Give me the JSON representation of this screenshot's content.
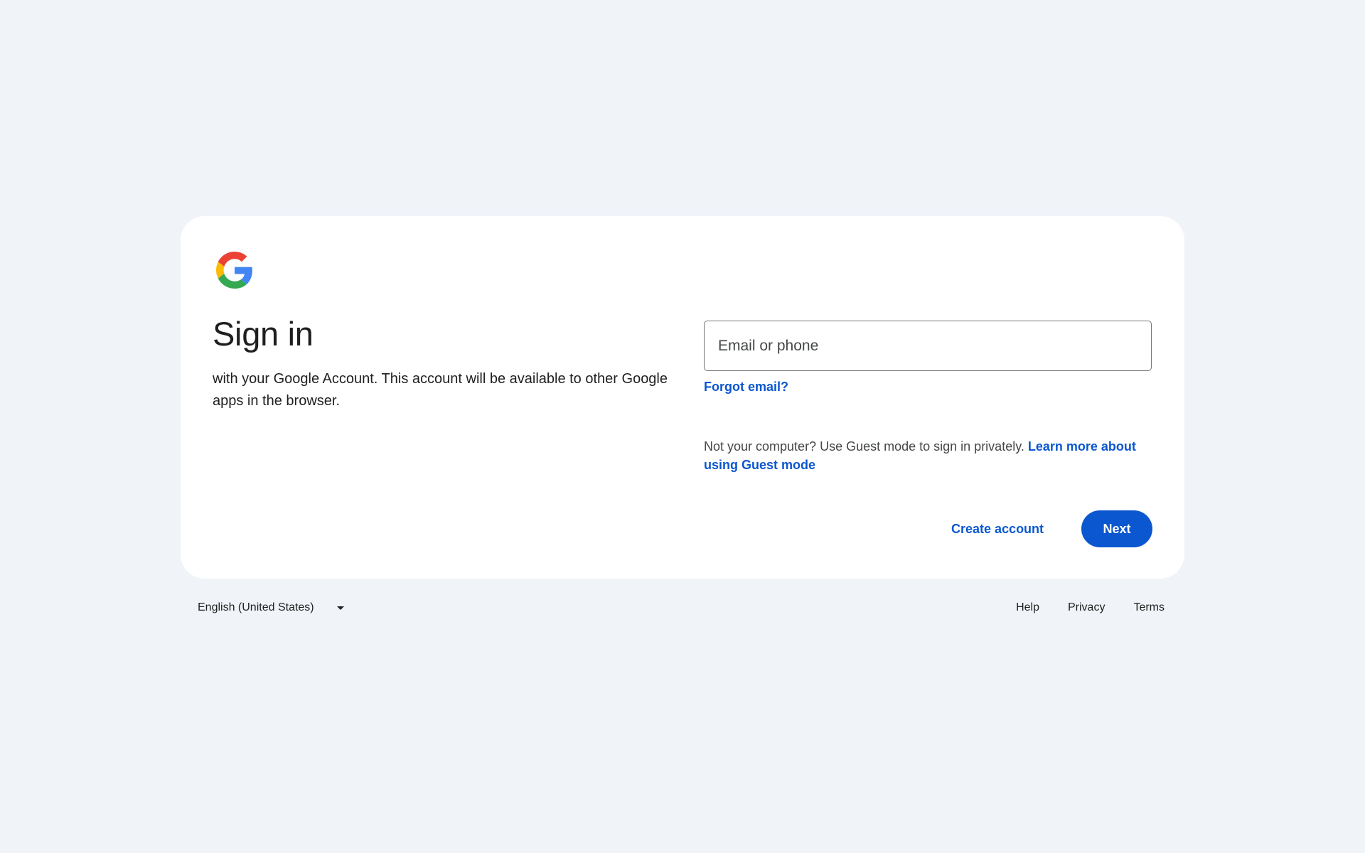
{
  "card": {
    "title": "Sign in",
    "subtitle": "with your Google Account. This account will be available to other Google apps in the browser."
  },
  "form": {
    "email_placeholder": "Email or phone",
    "email_value": "",
    "forgot_email": "Forgot email?",
    "guest_text": "Not your computer? Use Guest mode to sign in privately.",
    "guest_link": "Learn more about using Guest mode",
    "create_account": "Create account",
    "next": "Next"
  },
  "footer": {
    "language": "English (United States)",
    "links": [
      "Help",
      "Privacy",
      "Terms"
    ]
  },
  "colors": {
    "background": "#f0f4f9",
    "accent": "#0b57d0",
    "logo_blue": "#4285F4",
    "logo_red": "#EA4335",
    "logo_yellow": "#FBBC05",
    "logo_green": "#34A853"
  },
  "icons": {
    "logo": "google-g-logo-icon",
    "language_dropdown": "caret-down-icon"
  }
}
